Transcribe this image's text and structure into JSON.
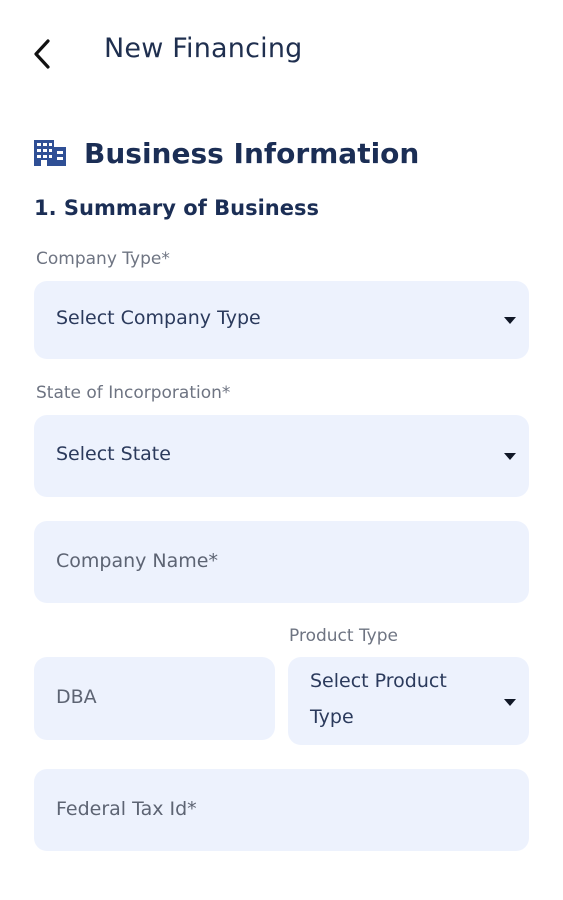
{
  "header": {
    "title": "New Financing",
    "back_icon": "chevron-left-icon"
  },
  "section": {
    "icon": "building-icon",
    "title": "Business Information",
    "subtitle": "1. Summary of Business"
  },
  "form": {
    "company_type": {
      "label": "Company Type*",
      "value": "Select Company Type"
    },
    "state_of_incorporation": {
      "label": "State of Incorporation*",
      "value": "Select State"
    },
    "company_name": {
      "placeholder": "Company Name*"
    },
    "dba": {
      "placeholder": "DBA"
    },
    "product_type": {
      "label": "Product Type",
      "value_line1": "Select Product",
      "value_line2": "Type"
    },
    "federal_tax_id": {
      "placeholder": "Federal Tax Id*"
    }
  },
  "colors": {
    "field_background": "#edf2fd",
    "heading": "#1b2e55",
    "label": "#6e7482"
  }
}
